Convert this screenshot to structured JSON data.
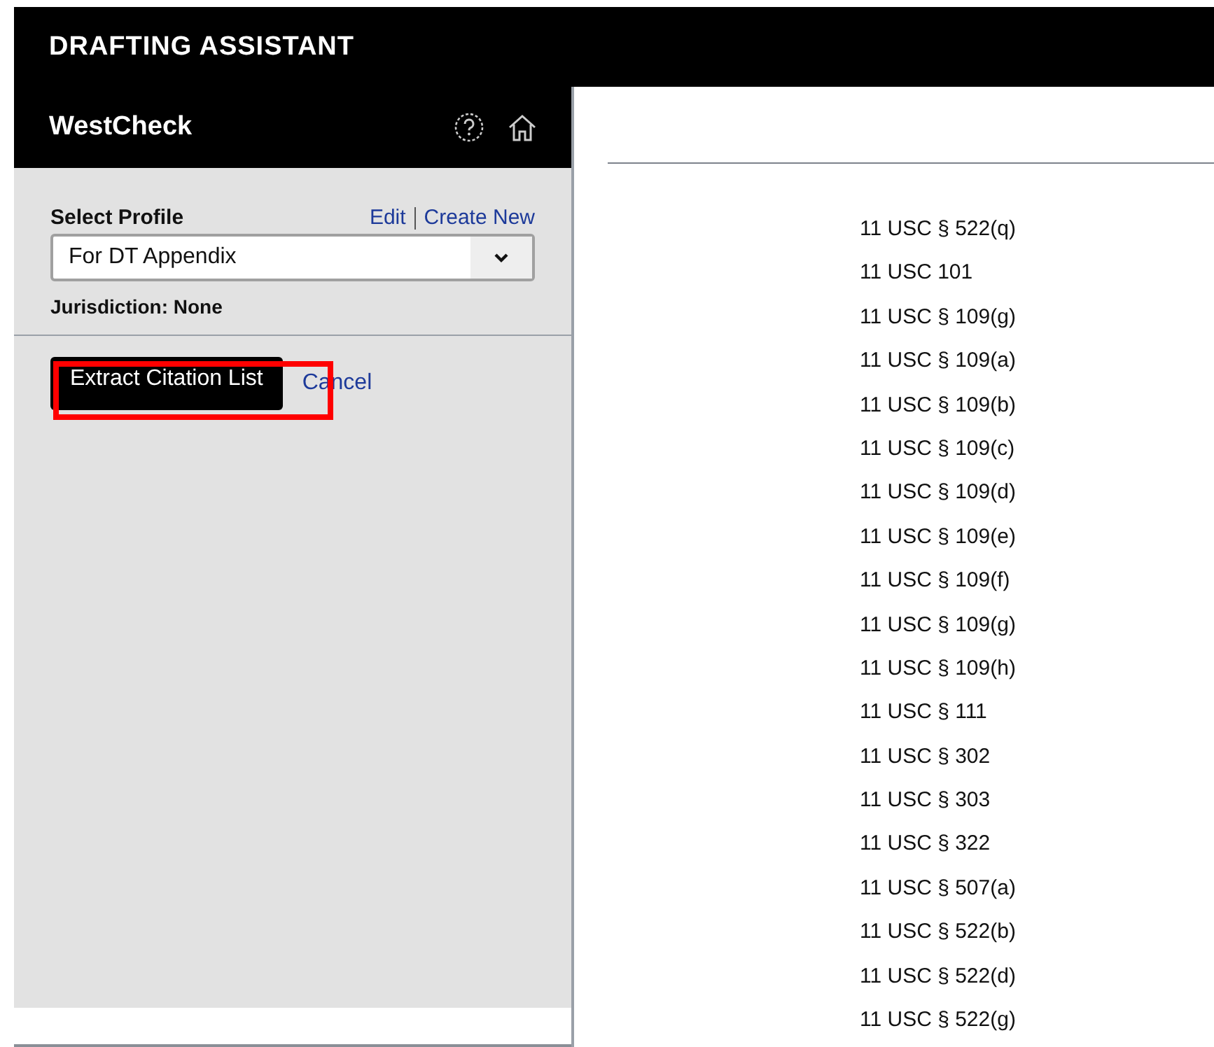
{
  "app_title": "DRAFTING ASSISTANT",
  "panel": {
    "title": "WestCheck",
    "profile_label": "Select Profile",
    "links": [
      "Edit",
      "Create New"
    ],
    "profile_value": "For DT Appendix",
    "jurisdiction": "Jurisdiction: None",
    "primary_button": "Extract Citation List",
    "cancel_link": "Cancel"
  },
  "citations": [
    "11 USC § 522(q)",
    "11 USC 101",
    "11 USC § 109(g)",
    "11 USC § 109(a)",
    "11 USC § 109(b)",
    "11 USC § 109(c)",
    "11 USC § 109(d)",
    "11 USC § 109(e)",
    "11 USC § 109(f)",
    "11 USC § 109(g)",
    "11 USC § 109(h)",
    "11 USC § 111",
    "11 USC § 302",
    "11 USC § 303",
    "11 USC § 322",
    "11 USC § 507(a)",
    "11 USC § 522(b)",
    "11 USC § 522(d)",
    "11 USC § 522(g)"
  ]
}
